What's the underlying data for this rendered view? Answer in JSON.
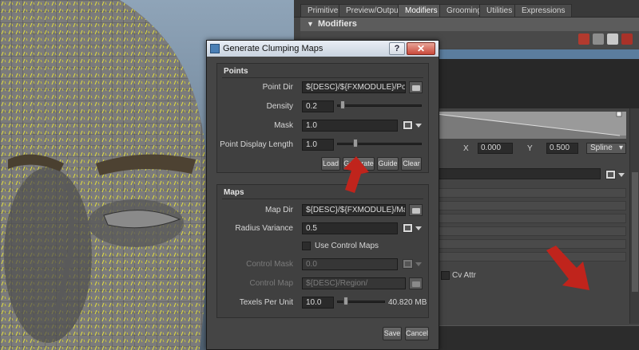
{
  "editor": {
    "tabs": [
      "Primitives",
      "Preview/Output",
      "Modifiers",
      "Grooming",
      "Utilities",
      "Expressions"
    ],
    "active_tab": "Modifiers",
    "section_title": "Modifiers",
    "ramp": {
      "x_label": "X",
      "x_value": "0.000",
      "y_label": "Y",
      "y_value": "0.500",
      "interp": "Spline"
    },
    "cv_attr_label": "Cv Attr"
  },
  "dialog": {
    "title": "Generate Clumping Maps",
    "help_label": "?",
    "close_label": "✕",
    "points": {
      "group_title": "Points",
      "point_dir_label": "Point Dir",
      "point_dir_value": "${DESC}/${FXMODULE}/Points/",
      "density_label": "Density",
      "density_value": "0.2",
      "density_fraction": 0.2,
      "mask_label": "Mask",
      "mask_value": "1.0",
      "display_length_label": "Point Display Length",
      "display_length_value": "1.0",
      "buttons": {
        "load": "Load",
        "generate": "Generate",
        "guide": "Guide",
        "clear": "Clear"
      }
    },
    "maps": {
      "group_title": "Maps",
      "map_dir_label": "Map Dir",
      "map_dir_value": "${DESC}/${FXMODULE}/Maps/",
      "radius_variance_label": "Radius Variance",
      "radius_variance_value": "0.5",
      "use_control_maps_label": "Use Control Maps",
      "control_mask_label": "Control Mask",
      "control_mask_value": "0.0",
      "control_map_label": "Control Map",
      "control_map_value": "${DESC}/Region/",
      "texels_label": "Texels Per Unit",
      "texels_value": "10.0",
      "memory_readout": "40.820 MB"
    },
    "footer": {
      "save": "Save",
      "cancel": "Cancel"
    }
  },
  "colors": {
    "accent_red": "#c0241c",
    "hair_yellow": "#e8e43a"
  }
}
